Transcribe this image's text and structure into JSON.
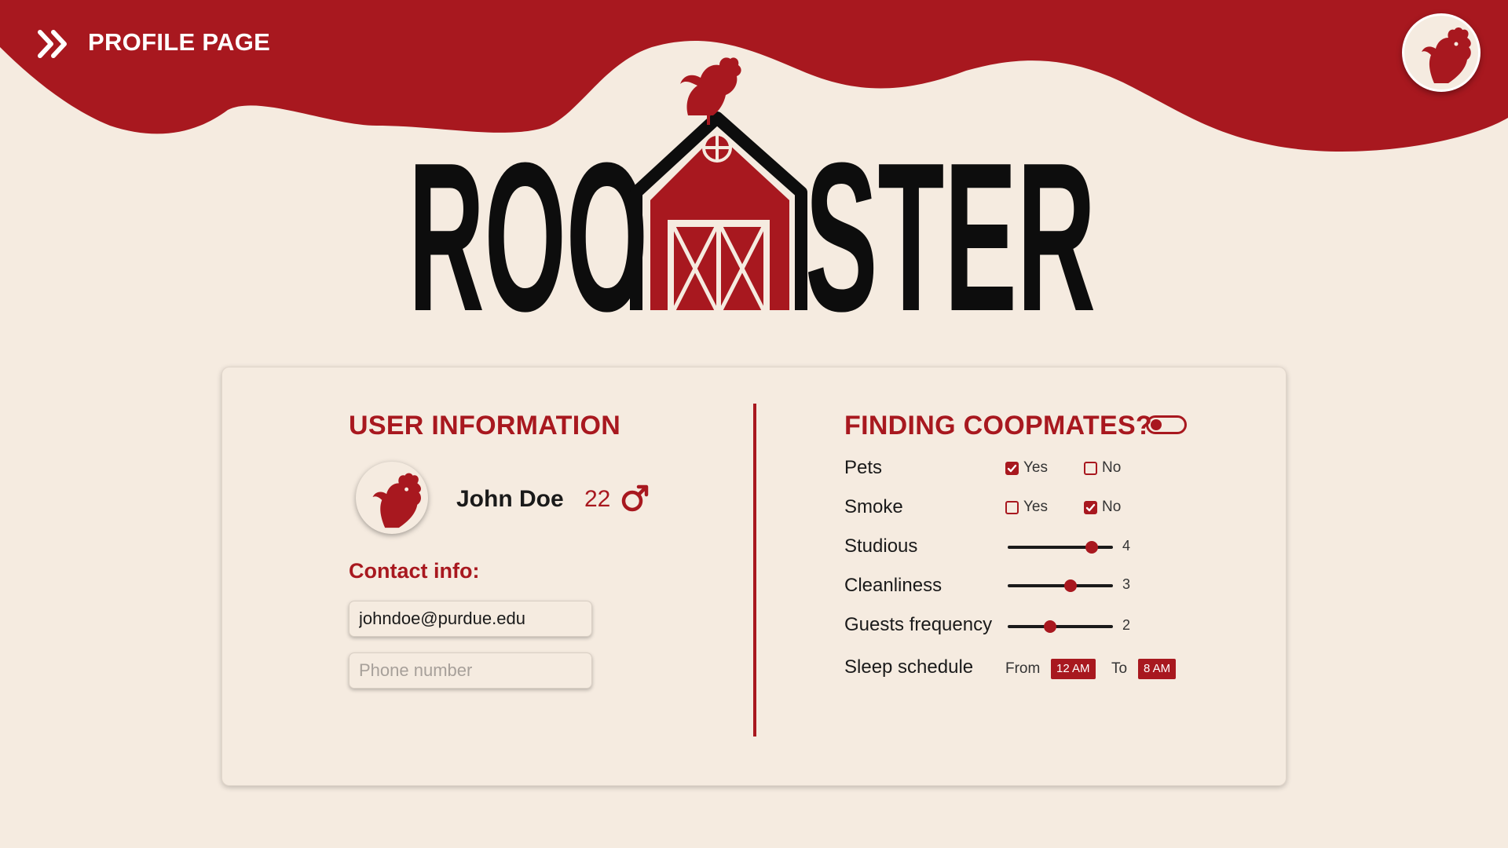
{
  "header": {
    "title": "PROFILE PAGE",
    "back_icon": "double-chevron-right-icon",
    "avatar_icon": "rooster-icon"
  },
  "logo": {
    "text_left": "ROO",
    "text_right": "STER",
    "barn_icon": "barn-icon",
    "rooster_icon": "rooster-icon"
  },
  "user_info": {
    "title": "USER INFORMATION",
    "name": "John Doe",
    "age": "22",
    "gender_icon": "male-symbol-icon",
    "contact_label": "Contact info:",
    "email_value": "johndoe@purdue.edu",
    "email_placeholder": "",
    "phone_value": "",
    "phone_placeholder": "Phone number"
  },
  "preferences": {
    "title": "FINDING COOPMATES?",
    "toggle_on": false,
    "pets": {
      "label": "Pets",
      "yes_label": "Yes",
      "no_label": "No",
      "selected": "yes"
    },
    "smoke": {
      "label": "Smoke",
      "yes_label": "Yes",
      "no_label": "No",
      "selected": "no"
    },
    "studious": {
      "label": "Studious",
      "value": 4,
      "min": 0,
      "max": 5,
      "display": "4"
    },
    "cleanliness": {
      "label": "Cleanliness",
      "value": 3,
      "min": 0,
      "max": 5,
      "display": "3"
    },
    "guests": {
      "label": "Guests frequency",
      "value": 2,
      "min": 0,
      "max": 5,
      "display": "2"
    },
    "sleep": {
      "label": "Sleep schedule",
      "from_label": "From",
      "from_value": "12 AM",
      "to_label": "To",
      "to_value": "8 AM"
    }
  },
  "colors": {
    "accent": "#a8181f",
    "background": "#f5ebe0",
    "text": "#1a1a1a"
  }
}
